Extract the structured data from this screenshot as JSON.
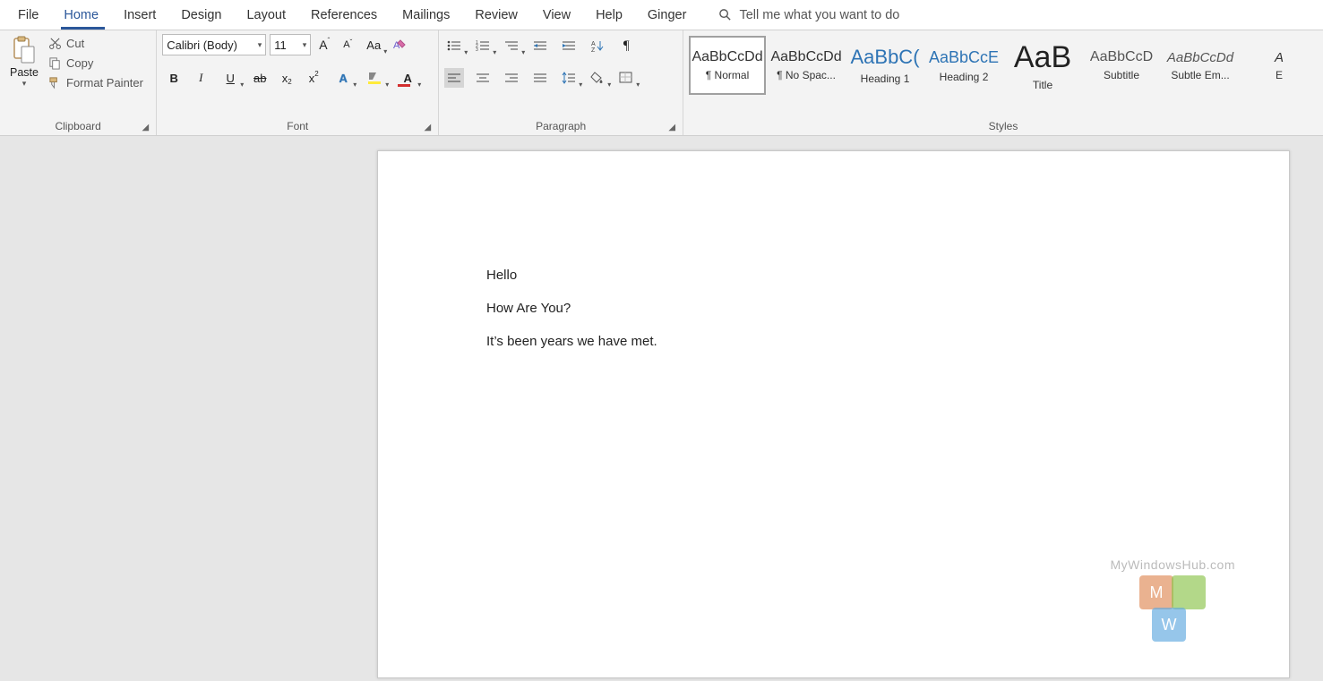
{
  "tabs": {
    "file": "File",
    "home": "Home",
    "insert": "Insert",
    "design": "Design",
    "layout": "Layout",
    "references": "References",
    "mailings": "Mailings",
    "review": "Review",
    "view": "View",
    "help": "Help",
    "ginger": "Ginger"
  },
  "tell_me": "Tell me what you want to do",
  "clipboard": {
    "paste": "Paste",
    "cut": "Cut",
    "copy": "Copy",
    "format_painter": "Format Painter",
    "label": "Clipboard"
  },
  "font": {
    "name": "Calibri (Body)",
    "size": "11",
    "label": "Font"
  },
  "paragraph": {
    "label": "Paragraph"
  },
  "styles": {
    "label": "Styles",
    "items": [
      {
        "preview": "AaBbCcDd",
        "name": "¶ Normal",
        "color": "#333",
        "size": "16px",
        "weight": "400",
        "style": "normal"
      },
      {
        "preview": "AaBbCcDd",
        "name": "¶ No Spac...",
        "color": "#333",
        "size": "16px",
        "weight": "400",
        "style": "normal"
      },
      {
        "preview": "AaBbC(",
        "name": "Heading 1",
        "color": "#2e74b5",
        "size": "22px",
        "weight": "400",
        "style": "normal"
      },
      {
        "preview": "AaBbCcE",
        "name": "Heading 2",
        "color": "#2e74b5",
        "size": "18px",
        "weight": "400",
        "style": "normal"
      },
      {
        "preview": "AaB",
        "name": "Title",
        "color": "#222",
        "size": "34px",
        "weight": "400",
        "style": "normal"
      },
      {
        "preview": "AaBbCcD",
        "name": "Subtitle",
        "color": "#555",
        "size": "16px",
        "weight": "400",
        "style": "normal"
      },
      {
        "preview": "AaBbCcDd",
        "name": "Subtle Em...",
        "color": "#555",
        "size": "15px",
        "weight": "400",
        "style": "italic"
      },
      {
        "preview": "A",
        "name": "E",
        "color": "#333",
        "size": "15px",
        "weight": "400",
        "style": "italic"
      }
    ]
  },
  "document": {
    "lines": [
      "Hello",
      "How Are You?",
      "It’s been years we have met."
    ]
  },
  "watermark": {
    "text": "MyWindowsHub.com",
    "m": "M",
    "w": "W"
  }
}
